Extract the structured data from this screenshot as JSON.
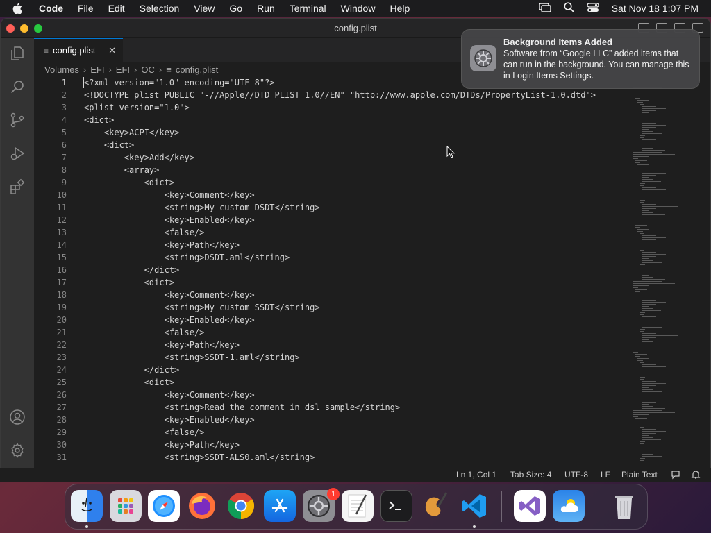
{
  "menubar": {
    "app_name": "Code",
    "items": [
      "File",
      "Edit",
      "Selection",
      "View",
      "Go",
      "Run",
      "Terminal",
      "Window",
      "Help"
    ],
    "clock": "Sat Nov 18  1:07 PM"
  },
  "window": {
    "title": "config.plist"
  },
  "tab": {
    "label": "config.plist"
  },
  "breadcrumb": [
    "Volumes",
    "EFI",
    "EFI",
    "OC",
    "config.plist"
  ],
  "editor": {
    "active_line": 1,
    "lines": [
      {
        "n": "1",
        "text": "<?xml version=\"1.0\" encoding=\"UTF-8\"?>"
      },
      {
        "n": "2",
        "pre": "<!DOCTYPE plist PUBLIC \"-//Apple//DTD PLIST 1.0//EN\" \"",
        "url": "http://www.apple.com/DTDs/PropertyList-1.0.dtd",
        "post": "\">"
      },
      {
        "n": "3",
        "text": "<plist version=\"1.0\">"
      },
      {
        "n": "4",
        "text": "<dict>"
      },
      {
        "n": "5",
        "text": "    <key>ACPI</key>"
      },
      {
        "n": "6",
        "text": "    <dict>"
      },
      {
        "n": "7",
        "text": "        <key>Add</key>"
      },
      {
        "n": "8",
        "text": "        <array>"
      },
      {
        "n": "9",
        "text": "            <dict>"
      },
      {
        "n": "10",
        "text": "                <key>Comment</key>"
      },
      {
        "n": "11",
        "text": "                <string>My custom DSDT</string>"
      },
      {
        "n": "12",
        "text": "                <key>Enabled</key>"
      },
      {
        "n": "13",
        "text": "                <false/>"
      },
      {
        "n": "14",
        "text": "                <key>Path</key>"
      },
      {
        "n": "15",
        "text": "                <string>DSDT.aml</string>"
      },
      {
        "n": "16",
        "text": "            </dict>"
      },
      {
        "n": "17",
        "text": "            <dict>"
      },
      {
        "n": "18",
        "text": "                <key>Comment</key>"
      },
      {
        "n": "19",
        "text": "                <string>My custom SSDT</string>"
      },
      {
        "n": "20",
        "text": "                <key>Enabled</key>"
      },
      {
        "n": "21",
        "text": "                <false/>"
      },
      {
        "n": "22",
        "text": "                <key>Path</key>"
      },
      {
        "n": "23",
        "text": "                <string>SSDT-1.aml</string>"
      },
      {
        "n": "24",
        "text": "            </dict>"
      },
      {
        "n": "25",
        "text": "            <dict>"
      },
      {
        "n": "26",
        "text": "                <key>Comment</key>"
      },
      {
        "n": "27",
        "text": "                <string>Read the comment in dsl sample</string>"
      },
      {
        "n": "28",
        "text": "                <key>Enabled</key>"
      },
      {
        "n": "29",
        "text": "                <false/>"
      },
      {
        "n": "30",
        "text": "                <key>Path</key>"
      },
      {
        "n": "31",
        "text": "                <string>SSDT-ALS0.aml</string>"
      }
    ]
  },
  "statusbar": {
    "position": "Ln 1, Col 1",
    "tab_size": "Tab Size: 4",
    "encoding": "UTF-8",
    "eol": "LF",
    "language": "Plain Text"
  },
  "notification": {
    "title": "Background Items Added",
    "body": "Software from “Google LLC” added items that can run in the background. You can manage this in Login Items Settings."
  },
  "dock": {
    "settings_badge": "1",
    "apps": [
      "finder-icon",
      "launchpad-icon",
      "safari-icon",
      "firefox-icon",
      "chrome-icon",
      "app-store-icon",
      "system-settings-icon",
      "textedit-icon",
      "terminal-icon",
      "instruments-icon",
      "vscode-icon",
      "visual-studio-icon",
      "weather-icon",
      "trash-icon"
    ]
  },
  "colors": {
    "editor_bg": "#1e1e1e",
    "activity_bar": "#333333",
    "accent": "#0078d4",
    "text": "#d4d4d4",
    "line_number": "#858585"
  }
}
